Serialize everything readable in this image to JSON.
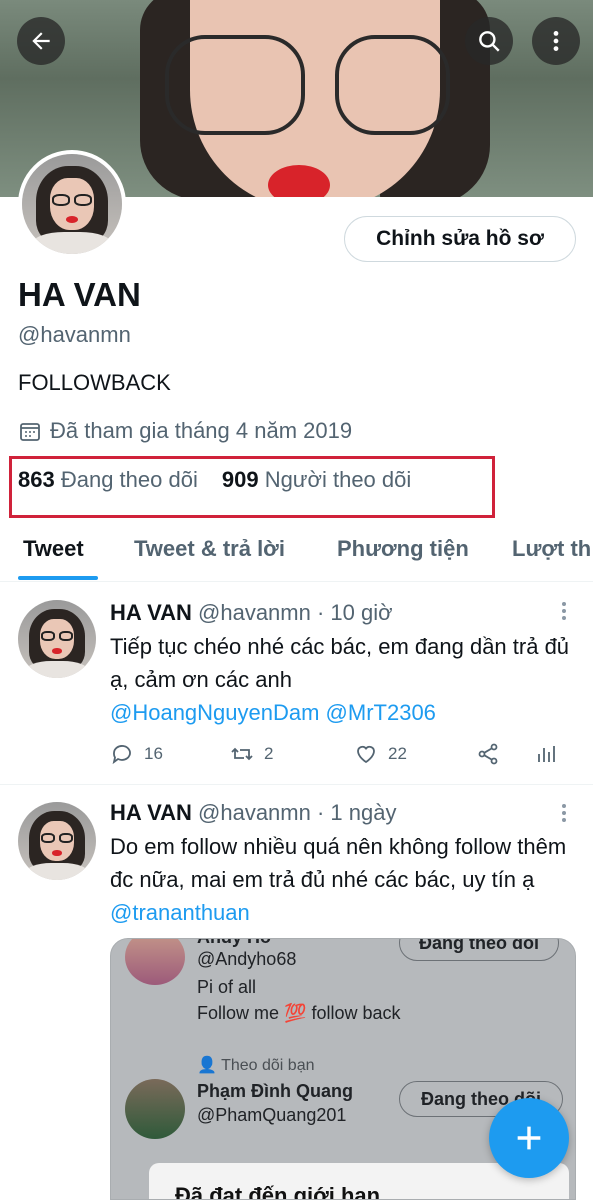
{
  "profile": {
    "name": "HA VAN",
    "handle": "@havanmn",
    "bio": "FOLLOWBACK",
    "joined": "Đã tham gia tháng 4 năm 2019",
    "following_count": "863",
    "following_label": "Đang theo dõi",
    "followers_count": "909",
    "followers_label": "Người theo dõi",
    "edit_button": "Chỉnh sửa hồ sơ"
  },
  "tabs": [
    {
      "label": "Tweet",
      "active": true
    },
    {
      "label": "Tweet & trả lời"
    },
    {
      "label": "Phương tiện"
    },
    {
      "label": "Lượt th"
    }
  ],
  "tweets": [
    {
      "name": "HA VAN",
      "meta": "@havanmn · 10 giờ",
      "text": "Tiếp tục chéo nhé các bác, em đang dần trả đủ ạ, cảm ơn các anh",
      "mentions": "@HoangNguyenDam @MrT2306",
      "replies": "16",
      "retweets": "2",
      "likes": "22"
    },
    {
      "name": "HA VAN",
      "meta": "@havanmn · 1 ngày",
      "text": "Do em follow nhiều quá nên không follow thêm đc nữa, mai em trả đủ nhé các bác, uy tín ạ",
      "mention": "@trananthuan"
    }
  ],
  "embed": {
    "top_name": "Andy Ho",
    "top_button": "Đang theo dõi",
    "user1_handle": "@Andyho68",
    "user1_line1": "Pi of all",
    "user1_line2_a": "Follow me",
    "user1_emoji": "💯",
    "user1_line2_b": "follow back",
    "follows_you": "Theo dõi bạn",
    "user2_name": "Phạm Đình Quang",
    "user2_handle": "@PhamQuang201",
    "user2_button": "Đang theo dõi",
    "dialog_text": "Đã đạt đến giới hạn"
  },
  "colors": {
    "accent": "#1d9bf0",
    "highlight_box": "#d0223a",
    "secondary_text": "#536471"
  }
}
